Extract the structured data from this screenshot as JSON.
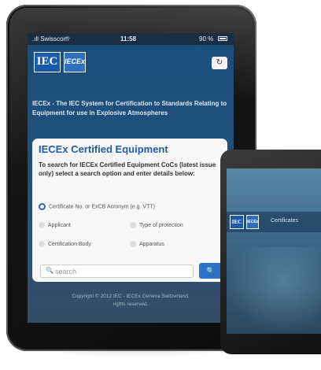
{
  "status_bar": {
    "carrier": ".ıll Swisscom",
    "wifi_icon": "wifi-icon",
    "time": "11:58",
    "battery": "90 %"
  },
  "header": {
    "logo_iec": "IEC",
    "logo_iecex": "IECEx",
    "refresh_icon": "refresh-icon",
    "refresh_glyph": "↻"
  },
  "intro": "IECEx - The IEC System for Certification to Standards Relating to Equipment for use in Explosive Atmospheres",
  "card": {
    "title": "IECEx Certified Equipment",
    "description": "To search for IECEx Certified Equipment CoCs (latest issue only) select a search option and enter details below:",
    "options": [
      {
        "label": "Certificate No. or ExCB Acronym (e.g. VTT)",
        "selected": true
      },
      {
        "label": "Applicant",
        "selected": false
      },
      {
        "label": "Type of protection",
        "selected": false
      },
      {
        "label": "Certification Body",
        "selected": false
      },
      {
        "label": "Apparatus",
        "selected": false
      }
    ],
    "search": {
      "placeholder": "search",
      "button_icon": "search-icon",
      "glyph": "🔍",
      "button_glyph": "🔍"
    }
  },
  "footer": {
    "line1": "Copyright © 2012 IEC - IECEx Geneva Switzerland,",
    "line2": "rights reserved."
  },
  "phone": {
    "logo_iec": "IEC",
    "logo_iecex": "IECEx",
    "label": "Certificates"
  },
  "colors": {
    "accent": "#1e5ea3",
    "screen_bg": "#214f78",
    "button": "#2b72c9"
  }
}
